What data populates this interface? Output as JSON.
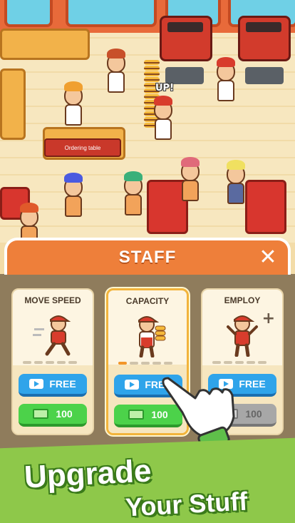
{
  "scene": {
    "up_label": "UP!",
    "ordering_table": "Ordering table"
  },
  "panel": {
    "title": "STAFF",
    "close_icon": "close-icon",
    "cards": [
      {
        "title": "MOVE SPEED",
        "free_label": "FREE",
        "cost": "100",
        "level": 0,
        "max_level": 5,
        "affordable": true
      },
      {
        "title": "CAPACITY",
        "free_label": "FREE",
        "cost": "100",
        "level": 1,
        "max_level": 5,
        "affordable": true
      },
      {
        "title": "EMPLOY",
        "free_label": "FREE",
        "cost": "100",
        "level": 0,
        "max_level": 5,
        "affordable": false
      }
    ]
  },
  "banner": {
    "line1": "Upgrade",
    "line2": "Your Stuff"
  },
  "colors": {
    "header": "#ee7f3a",
    "free_button": "#2fa4ea",
    "cash_button": "#4cd24a",
    "banner": "#8ec84a"
  }
}
